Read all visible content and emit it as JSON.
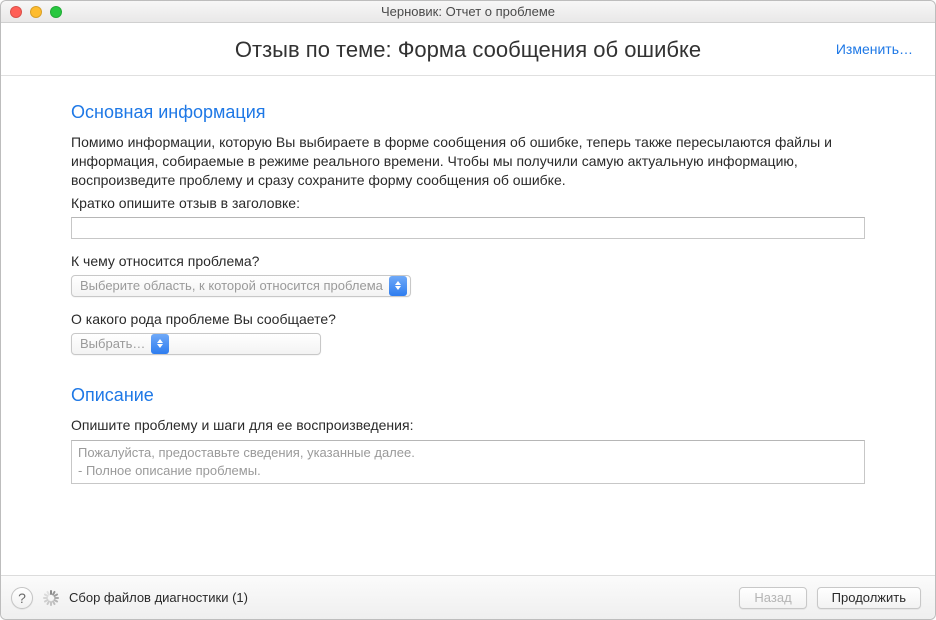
{
  "window": {
    "title": "Черновик: Отчет о проблеме"
  },
  "header": {
    "title": "Отзыв по теме: Форма сообщения об ошибке",
    "change_label": "Изменить…"
  },
  "sections": {
    "basic": {
      "title": "Основная информация",
      "intro": "Помимо информации, которую Вы выбираете в форме сообщения об ошибке, теперь также пересылаются файлы и информация, собираемые в режиме реального времени. Чтобы мы получили самую актуальную информацию, воспроизведите проблему и сразу сохраните форму сообщения об ошибке.",
      "title_label": "Кратко опишите отзыв в заголовке:",
      "title_value": "",
      "area_label": "К чему относится проблема?",
      "area_placeholder": "Выберите область, к которой относится проблема",
      "type_label": "О какого рода проблеме Вы сообщаете?",
      "type_placeholder": "Выбрать…"
    },
    "desc": {
      "title": "Описание",
      "steps_label": "Опишите проблему и шаги для ее воспроизведения:",
      "steps_placeholder_line1": "Пожалуйста, предоставьте сведения, указанные далее.",
      "steps_placeholder_line2": "- Полное описание проблемы."
    }
  },
  "footer": {
    "status": "Сбор файлов диагностики (1)",
    "back_label": "Назад",
    "continue_label": "Продолжить",
    "help_glyph": "?"
  }
}
